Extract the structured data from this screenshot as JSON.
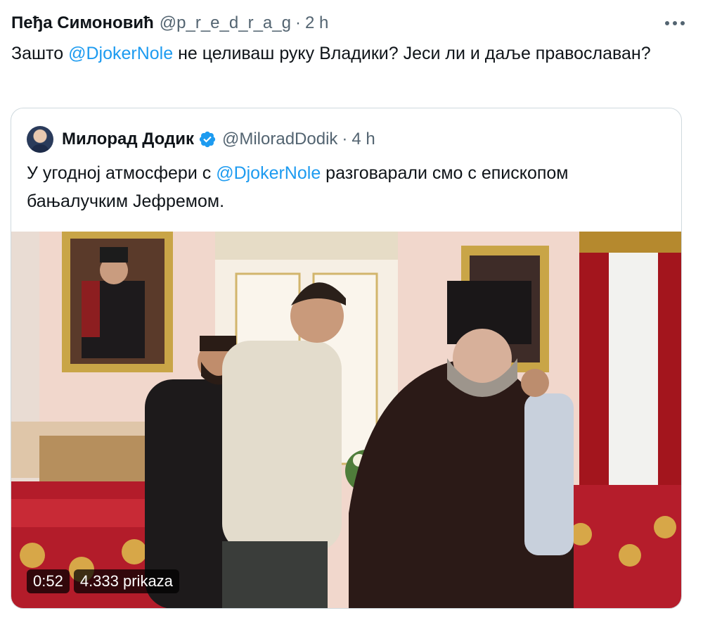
{
  "post": {
    "author_name": "Пеђа Симоновић",
    "author_handle": "@p_r_e_d_r_a_g",
    "separator": "·",
    "time": "2 h",
    "text_before": "Зашто ",
    "mention": "@DjokerNole",
    "text_after": " не целиваш руку Владики? Јеси ли и даље православан?"
  },
  "quote": {
    "author_name": "Милорад Додик",
    "author_handle": "@MiloradDodik",
    "separator": "·",
    "time": "4 h",
    "text_before": "У угодној атмосфери с ",
    "mention": "@DjokerNole",
    "text_after": " разговарали смо с епископом бањалучким Јефремом."
  },
  "video": {
    "duration": "0:52",
    "views": "4.333 prikaza"
  },
  "colors": {
    "link": "#1d9bf0",
    "muted": "#536471",
    "verified": "#1d9bf0"
  },
  "icons": {
    "more": "more-horizontal-icon",
    "verified": "verified-badge-icon"
  }
}
